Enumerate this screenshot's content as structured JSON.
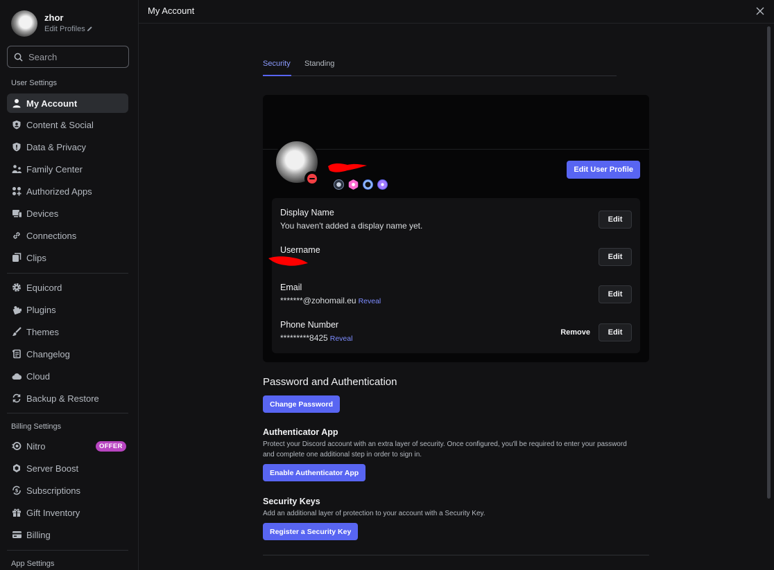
{
  "sidebar": {
    "profile": {
      "name": "zhor",
      "edit_label": "Edit Profiles"
    },
    "search": {
      "placeholder": "Search"
    },
    "user_settings_title": "User Settings",
    "user_settings": [
      {
        "label": "My Account",
        "icon": "person-icon",
        "active": true
      },
      {
        "label": "Content & Social",
        "icon": "shield-person-icon"
      },
      {
        "label": "Data & Privacy",
        "icon": "shield-icon"
      },
      {
        "label": "Family Center",
        "icon": "family-icon"
      },
      {
        "label": "Authorized Apps",
        "icon": "apps-icon"
      },
      {
        "label": "Devices",
        "icon": "devices-icon"
      },
      {
        "label": "Connections",
        "icon": "link-icon"
      },
      {
        "label": "Clips",
        "icon": "clips-icon"
      }
    ],
    "plugin_settings": [
      {
        "label": "Equicord",
        "icon": "gear-icon"
      },
      {
        "label": "Plugins",
        "icon": "puzzle-icon"
      },
      {
        "label": "Themes",
        "icon": "brush-icon"
      },
      {
        "label": "Changelog",
        "icon": "scroll-icon"
      },
      {
        "label": "Cloud",
        "icon": "cloud-icon"
      },
      {
        "label": "Backup & Restore",
        "icon": "refresh-icon"
      }
    ],
    "billing_settings_title": "Billing Settings",
    "billing_settings": [
      {
        "label": "Nitro",
        "icon": "nitro-icon",
        "badge": "OFFER"
      },
      {
        "label": "Server Boost",
        "icon": "boost-icon"
      },
      {
        "label": "Subscriptions",
        "icon": "subscriptions-icon"
      },
      {
        "label": "Gift Inventory",
        "icon": "gift-icon"
      },
      {
        "label": "Billing",
        "icon": "card-icon"
      }
    ],
    "app_settings_title": "App Settings"
  },
  "header": {
    "title": "My Account"
  },
  "tabs": [
    {
      "label": "Security",
      "active": true
    },
    {
      "label": "Standing"
    }
  ],
  "profile_card": {
    "edit_button": "Edit User Profile",
    "fields": [
      {
        "label": "Display Name",
        "value": "You haven't added a display name yet.",
        "action": "Edit"
      },
      {
        "label": "Username",
        "value": "",
        "action": "Edit"
      },
      {
        "label": "Email",
        "value": "*******@zohomail.eu",
        "reveal": "Reveal",
        "action": "Edit"
      },
      {
        "label": "Phone Number",
        "value": "*********8425",
        "reveal": "Reveal",
        "action": "Edit",
        "secondary_action": "Remove"
      }
    ]
  },
  "password_section": {
    "title": "Password and Authentication",
    "change_password": "Change Password",
    "authenticator": {
      "title": "Authenticator App",
      "description": "Protect your Discord account with an extra layer of security. Once configured, you'll be required to enter your password and complete one additional step in order to sign in.",
      "button": "Enable Authenticator App"
    },
    "security_keys": {
      "title": "Security Keys",
      "description": "Add an additional layer of protection to your account with a Security Key.",
      "button": "Register a Security Key"
    }
  },
  "colors": {
    "accent": "#5865f2",
    "offer_badge": "#b845c1",
    "dnd": "#f23f43",
    "redaction": "#ff0000"
  }
}
